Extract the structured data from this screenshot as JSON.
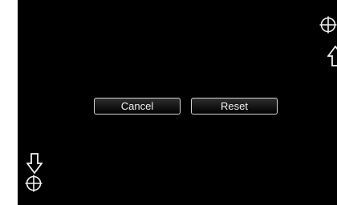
{
  "calibration_screen": {
    "buttons": {
      "cancel_label": "Cancel",
      "reset_label": "Reset"
    },
    "icons": {
      "top_right_target": "crosshair-target-icon",
      "top_right_arrow": "up-arrow-icon",
      "bottom_left_arrow": "down-arrow-icon",
      "bottom_left_target": "crosshair-target-icon"
    },
    "colors": {
      "background": "#000000",
      "foreground": "#f2f2f2",
      "border": "#d8d8d8"
    }
  }
}
